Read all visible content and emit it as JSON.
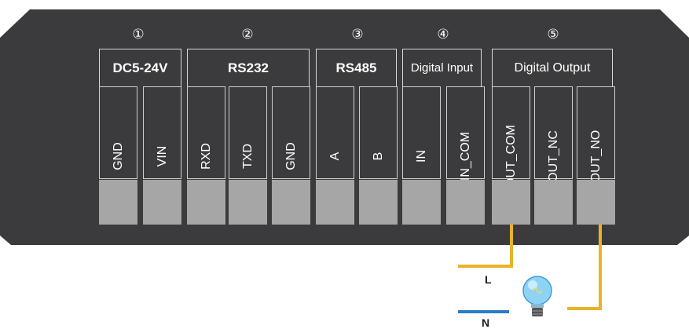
{
  "groups": [
    {
      "number": "①",
      "title": "DC5-24V"
    },
    {
      "number": "②",
      "title": "RS232"
    },
    {
      "number": "③",
      "title": "RS485"
    },
    {
      "number": "④",
      "title": "Digital Input"
    },
    {
      "number": "⑤",
      "title": "Digital Output"
    }
  ],
  "pins": [
    "GND",
    "VIN",
    "RXD",
    "TXD",
    "GND",
    "A",
    "B",
    "IN",
    "IN_COM",
    "OUT_COM",
    "OUT_NC",
    "OUT_NO"
  ],
  "wires": {
    "live_label": "L",
    "neutral_label": "N"
  },
  "colors": {
    "panel": "#3b3b3d",
    "terminal_block": "#a6a6a6",
    "live_wire": "#e9b327",
    "neutral_wire": "#2d7bc4",
    "bulb": "#8fd3f4"
  },
  "icons": {
    "load": "light-bulb-icon"
  }
}
